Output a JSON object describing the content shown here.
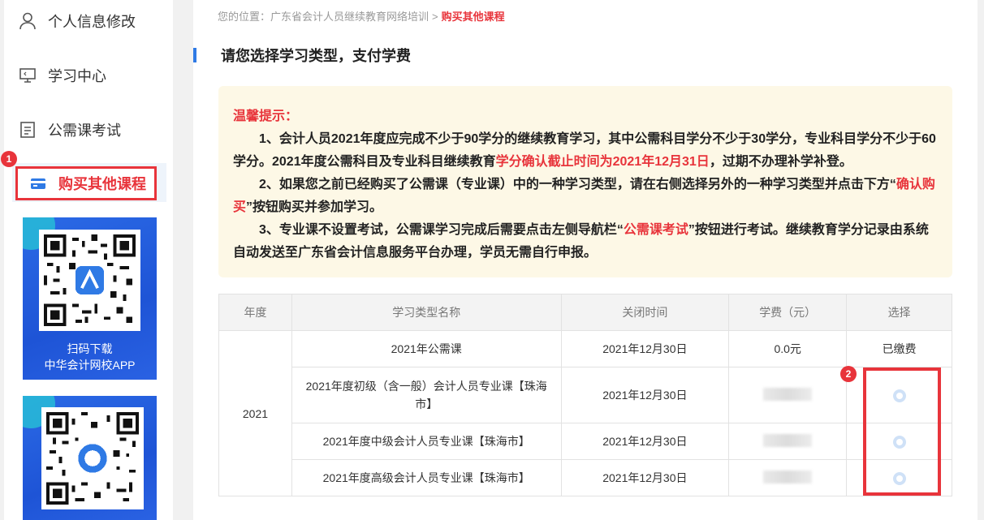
{
  "sidebar": {
    "items": [
      {
        "label": "个人信息修改",
        "icon": "user-icon"
      },
      {
        "label": "学习中心",
        "icon": "monitor-icon"
      },
      {
        "label": "公需课考试",
        "icon": "exam-doc-icon"
      },
      {
        "label": "购买其他课程",
        "icon": "wallet-icon",
        "active": true
      }
    ],
    "step_badge_1": "1",
    "qr_cards": [
      {
        "caption_line1": "扫码下载",
        "caption_line2": "中华会计网校APP"
      },
      {
        "caption_line1": "",
        "caption_line2": ""
      }
    ]
  },
  "breadcrumb": {
    "prefix": "您的位置：",
    "parent": "广东省会计人员继续教育网络培训",
    "separator": ">",
    "current": "购买其他课程"
  },
  "section_title": "请您选择学习类型，支付学费",
  "tip": {
    "heading": "温馨提示：",
    "p1_a": "1、会计人员2021年度应完成不少于90学分的继续教育学习，其中公需科目学分不少于30学分，专业科目学分不少于60学分。2021年度公需科目及专业科目继续教育",
    "p1_red": "学分确认截止时间为2021年12月31日",
    "p1_b": "，过期不办理补学补登。",
    "p2_a": "2、如果您之前已经购买了公需课（专业课）中的一种学习类型，请在右侧选择另外的一种学习类型并点击下方“",
    "p2_red": "确认购买",
    "p2_b": "”按钮购买并参加学习。",
    "p3_a": "3、专业课不设置考试，公需课学习完成后需要点击左侧导航栏“",
    "p3_red": "公需课考试",
    "p3_b": "”按钮进行考试。继续教育学分记录由系统自动发送至广东省会计信息服务平台办理，学员无需自行申报。"
  },
  "table": {
    "headers": [
      "年度",
      "学习类型名称",
      "关闭时间",
      "学费（元）",
      "选择"
    ],
    "year": "2021",
    "rows": [
      {
        "name": "2021年公需课",
        "close_time": "2021年12月30日",
        "fee": "0.0元",
        "select": "已缴费"
      },
      {
        "name": "2021年度初级（含一般）会计人员专业课【珠海市】",
        "close_time": "2021年12月30日",
        "fee": "",
        "select": ""
      },
      {
        "name": "2021年度中级会计人员专业课【珠海市】",
        "close_time": "2021年12月30日",
        "fee": "",
        "select": ""
      },
      {
        "name": "2021年度高级会计人员专业课【珠海市】",
        "close_time": "2021年12月30日",
        "fee": "",
        "select": ""
      }
    ]
  },
  "step_badge_2": "2",
  "colors": {
    "accent_red": "#e8343b",
    "brand_blue": "#2f7ae5",
    "tip_bg": "#fdf8e6"
  }
}
